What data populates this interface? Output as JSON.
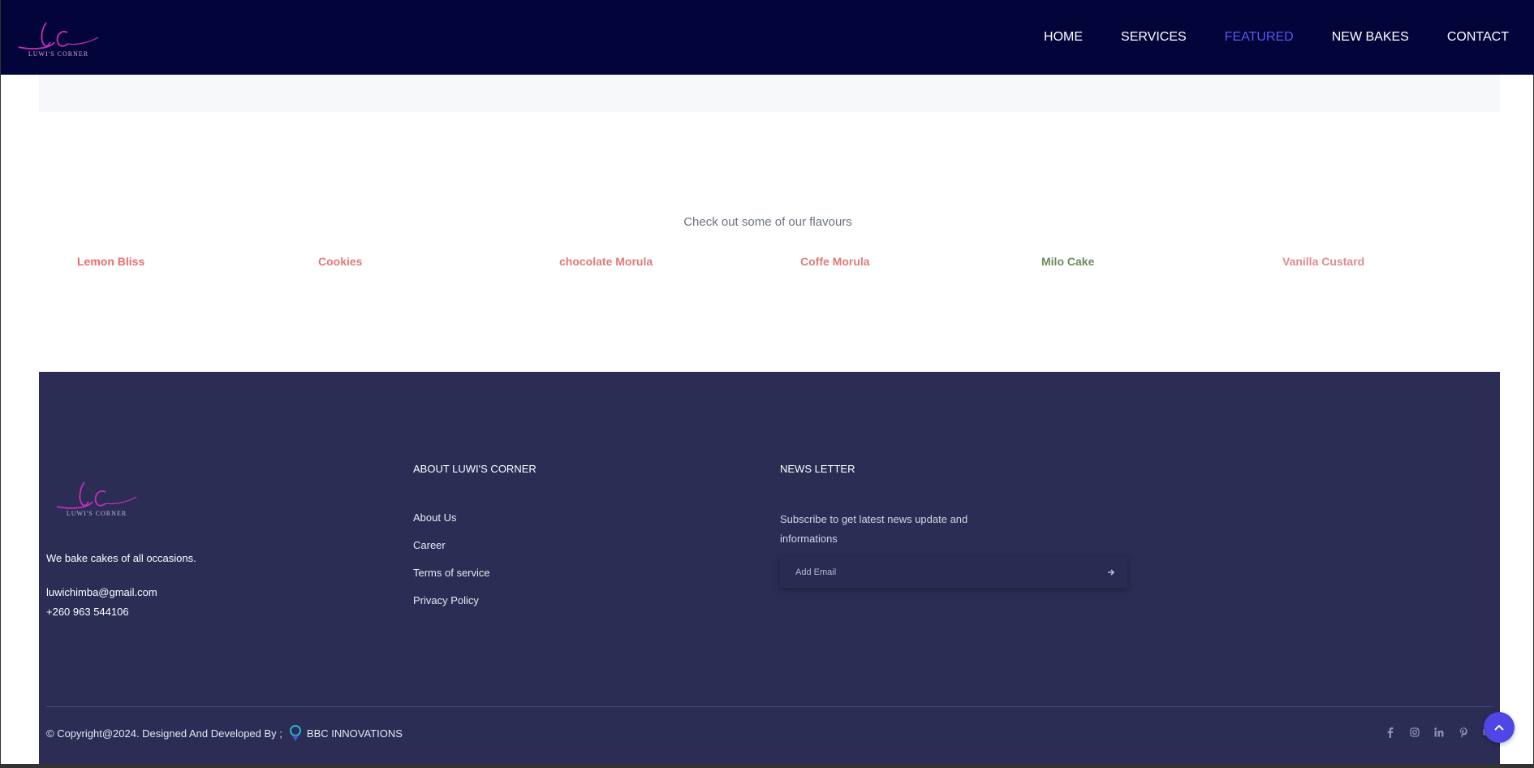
{
  "brand": {
    "logo_text": "LUWI'S CORNER",
    "accent_color": "#c42fb8"
  },
  "nav": {
    "items": [
      {
        "label": "HOME",
        "active": false
      },
      {
        "label": "SERVICES",
        "active": false
      },
      {
        "label": "FEATURED",
        "active": true
      },
      {
        "label": "NEW BAKES",
        "active": false
      },
      {
        "label": "CONTACT",
        "active": false
      }
    ],
    "active_color": "#5a56f0"
  },
  "flavours": {
    "title": "Check out some of our flavours",
    "items": [
      {
        "label": "Lemon Bliss",
        "color": "#f06a6a"
      },
      {
        "label": "Cookies",
        "color": "#e07a7a"
      },
      {
        "label": "chocolate Morula",
        "color": "#e07a7a"
      },
      {
        "label": "Coffe Morula",
        "color": "#e07a7a"
      },
      {
        "label": "Milo Cake",
        "color": "#6d8a5a"
      },
      {
        "label": "Vanilla Custard",
        "color": "#e08c8c"
      }
    ]
  },
  "footer": {
    "tagline": "We bake cakes of all occasions.",
    "email": "luwichimba@gmail.com",
    "phone": "+260 963 544106",
    "about": {
      "title": "ABOUT LUWI'S CORNER",
      "links": [
        "About Us",
        "Career",
        "Terms of service",
        "Privacy Policy"
      ]
    },
    "newsletter": {
      "title": "NEWS LETTER",
      "description": "Subscribe to get latest news update and informations",
      "email_placeholder": "Add Email",
      "send_icon": "arrow-right-icon"
    },
    "copyright": "© Copyright@2024. Designed And Developed By ;",
    "developer": "BBC INNOVATIONS",
    "socials": [
      "facebook-icon",
      "instagram-icon",
      "linkedin-icon",
      "pinterest-icon",
      "behance-icon"
    ]
  },
  "scroll_top": {
    "icon": "chevron-up-icon"
  },
  "colors": {
    "navbar_bg": "#03053a",
    "footer_bg": "#2b2d55",
    "scroll_top_bg": "#4f46e5"
  }
}
